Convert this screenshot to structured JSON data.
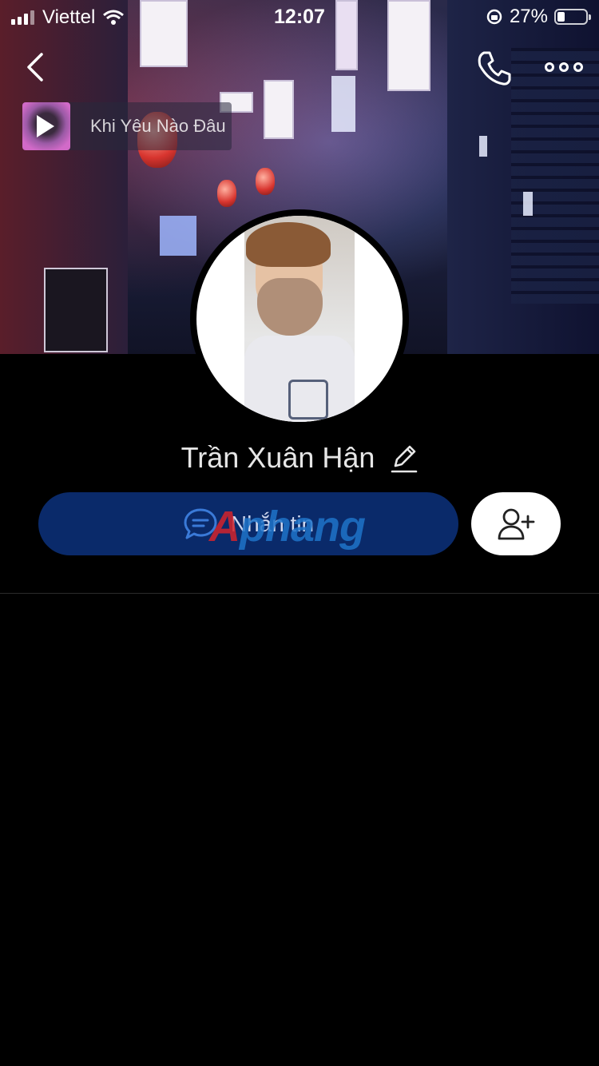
{
  "status_bar": {
    "carrier": "Viettel",
    "time": "12:07",
    "battery": "27%",
    "battery_level": 0.27
  },
  "nav": {
    "back_icon": "chevron-left-icon",
    "call_icon": "phone-icon",
    "more_icon": "more-dots-icon"
  },
  "music": {
    "song_title": "Khi Yêu Nào Đâu"
  },
  "profile": {
    "name": "Trần Xuân Hận"
  },
  "actions": {
    "message_label": "Nhắn tin",
    "add_friend_icon": "add-friend-icon"
  },
  "watermark": {
    "a": "A",
    "rest": "phang"
  },
  "colors": {
    "message_button_bg": "#0a2a6a",
    "background": "#000000"
  }
}
